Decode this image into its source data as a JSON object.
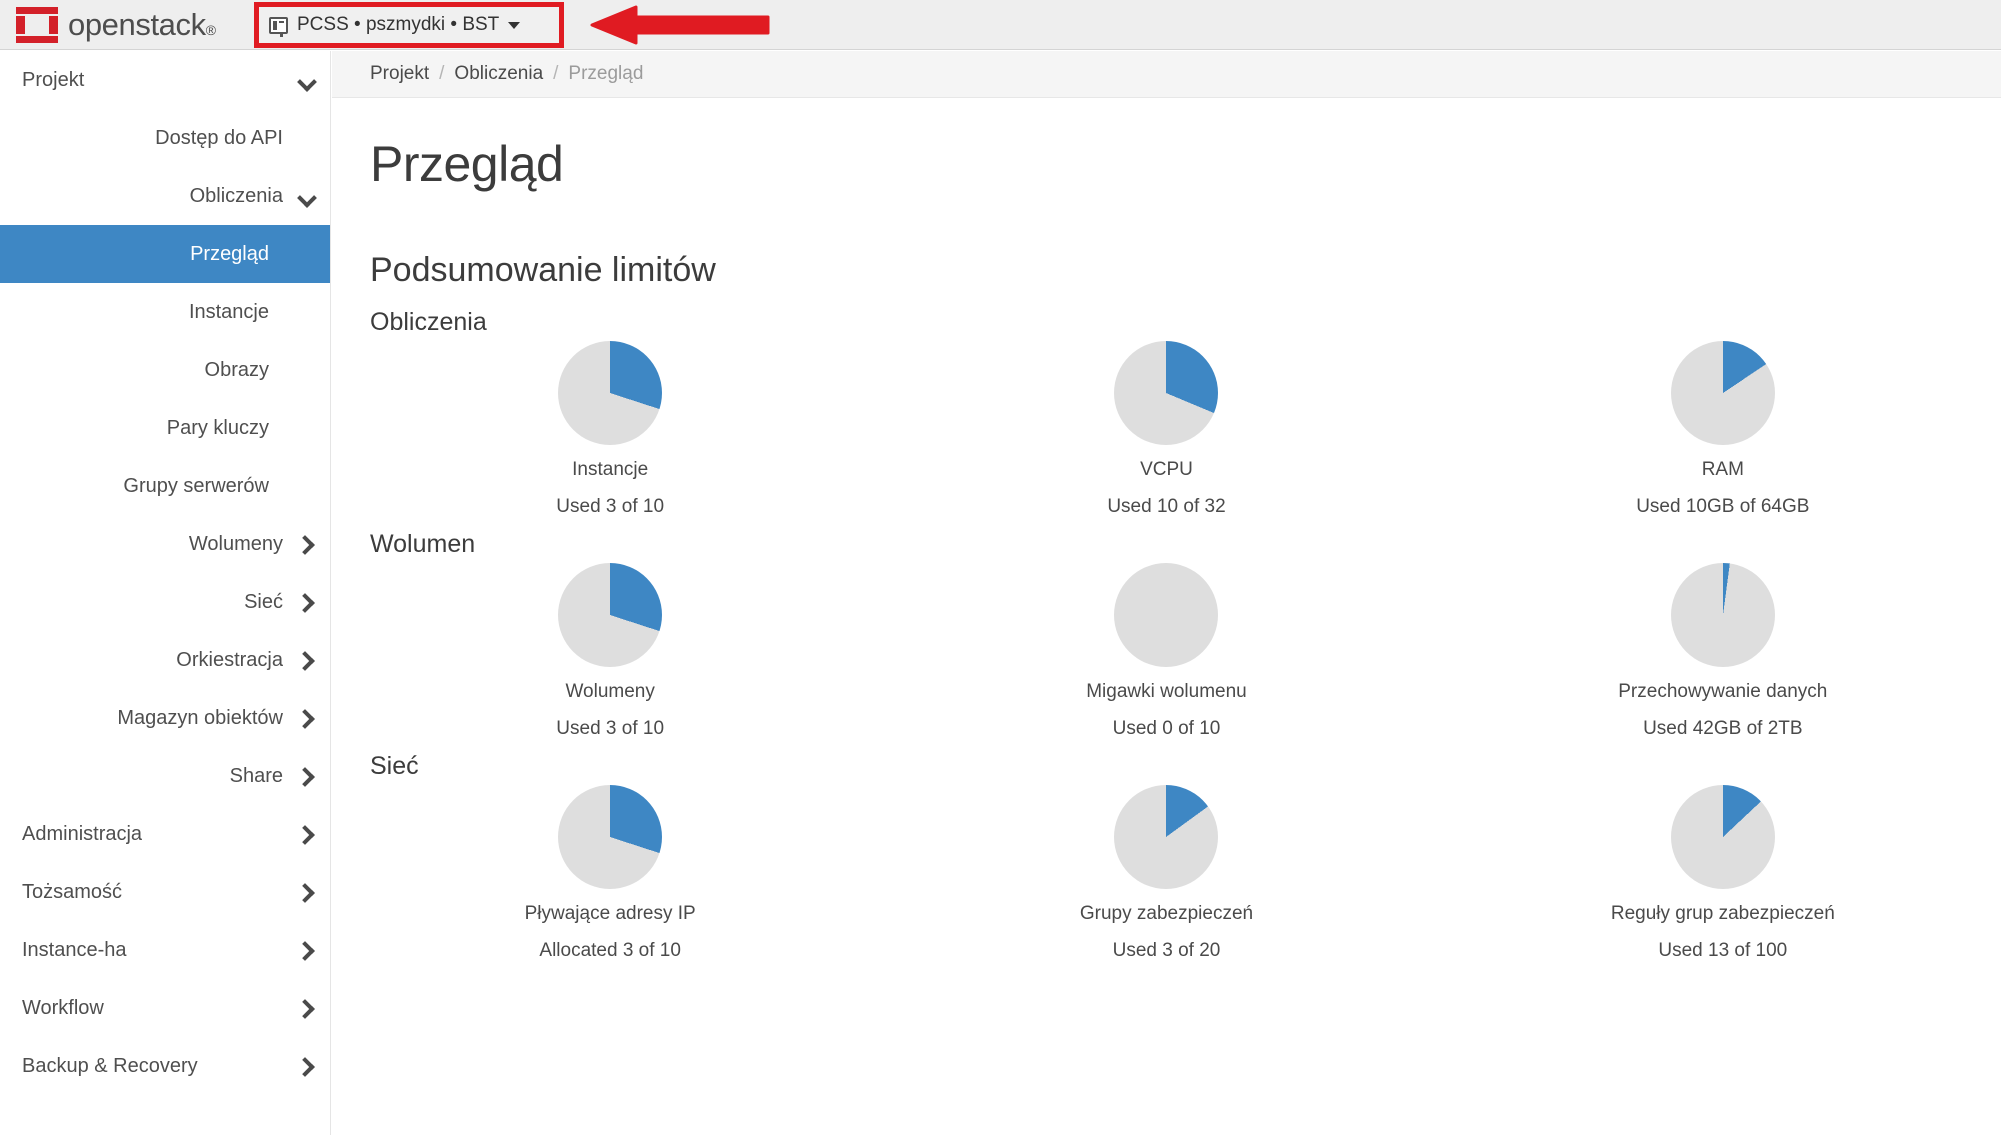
{
  "topbar": {
    "logo_text": "openstack",
    "logo_mark_color": "#d32029",
    "project_switcher": {
      "label": "PCSS • pszmydki • BST",
      "icon": "project-list-icon",
      "caret": "chevron-down-icon",
      "highlight_color": "#e01b22"
    },
    "annotation": {
      "shape": "left-pointing-arrow",
      "color": "#e01b22"
    }
  },
  "sidebar": {
    "items": [
      {
        "label": "Projekt",
        "level": 1,
        "chevron": "down",
        "active": false
      },
      {
        "label": "Dostęp do API",
        "level": 2,
        "chevron": "none",
        "active": false
      },
      {
        "label": "Obliczenia",
        "level": 2,
        "chevron": "down",
        "active": false
      },
      {
        "label": "Przegląd",
        "level": 3,
        "chevron": "none",
        "active": true
      },
      {
        "label": "Instancje",
        "level": 3,
        "chevron": "none",
        "active": false
      },
      {
        "label": "Obrazy",
        "level": 3,
        "chevron": "none",
        "active": false
      },
      {
        "label": "Pary kluczy",
        "level": 3,
        "chevron": "none",
        "active": false
      },
      {
        "label": "Grupy serwerów",
        "level": 3,
        "chevron": "none",
        "active": false
      },
      {
        "label": "Wolumeny",
        "level": 2,
        "chevron": "right",
        "active": false
      },
      {
        "label": "Sieć",
        "level": 2,
        "chevron": "right",
        "active": false
      },
      {
        "label": "Orkiestracja",
        "level": 2,
        "chevron": "right",
        "active": false
      },
      {
        "label": "Magazyn obiektów",
        "level": 2,
        "chevron": "right",
        "active": false
      },
      {
        "label": "Share",
        "level": 2,
        "chevron": "right",
        "active": false
      },
      {
        "label": "Administracja",
        "level": 1,
        "chevron": "right",
        "active": false
      },
      {
        "label": "Tożsamość",
        "level": 1,
        "chevron": "right",
        "active": false
      },
      {
        "label": "Instance-ha",
        "level": 1,
        "chevron": "right",
        "active": false
      },
      {
        "label": "Workflow",
        "level": 1,
        "chevron": "right",
        "active": false
      },
      {
        "label": "Backup & Recovery",
        "level": 1,
        "chevron": "right",
        "active": false
      }
    ],
    "active_bg": "#3e87c4"
  },
  "main": {
    "breadcrumb": [
      {
        "label": "Projekt",
        "current": false
      },
      {
        "label": "Obliczenia",
        "current": false
      },
      {
        "label": "Przegląd",
        "current": true
      }
    ],
    "breadcrumb_separator": "/",
    "page_title": "Przegląd",
    "limit_summary_title": "Podsumowanie limitów"
  },
  "chart_data": {
    "type": "pie",
    "title": "Podsumowanie limitów",
    "used_color": "#3e87c4",
    "free_color": "#dedede",
    "groups": [
      {
        "title": "Obliczenia",
        "items": [
          {
            "label": "Instancje",
            "usage_text": "Used 3 of 10",
            "used": 3,
            "total": 10,
            "percent": 30.0,
            "unit": ""
          },
          {
            "label": "VCPU",
            "usage_text": "Used 10 of 32",
            "used": 10,
            "total": 32,
            "percent": 31.3,
            "unit": ""
          },
          {
            "label": "RAM",
            "usage_text": "Used 10GB of 64GB",
            "used": 10,
            "total": 64,
            "percent": 15.6,
            "unit": "GB"
          }
        ]
      },
      {
        "title": "Wolumen",
        "items": [
          {
            "label": "Wolumeny",
            "usage_text": "Used 3 of 10",
            "used": 3,
            "total": 10,
            "percent": 30.0,
            "unit": ""
          },
          {
            "label": "Migawki wolumenu",
            "usage_text": "Used 0 of 10",
            "used": 0,
            "total": 10,
            "percent": 0.0,
            "unit": ""
          },
          {
            "label": "Przechowywanie danych",
            "usage_text": "Used 42GB of 2TB",
            "used": 42,
            "total": 2048,
            "percent": 2.1,
            "unit": "GB"
          }
        ]
      },
      {
        "title": "Sieć",
        "items": [
          {
            "label": "Pływające adresy IP",
            "usage_text": "Allocated 3 of 10",
            "used": 3,
            "total": 10,
            "percent": 30.0,
            "unit": ""
          },
          {
            "label": "Grupy zabezpieczeń",
            "usage_text": "Used 3 of 20",
            "used": 3,
            "total": 20,
            "percent": 15.0,
            "unit": ""
          },
          {
            "label": "Reguły grup zabezpieczeń",
            "usage_text": "Used 13 of 100",
            "used": 13,
            "total": 100,
            "percent": 13.0,
            "unit": ""
          }
        ]
      }
    ]
  }
}
